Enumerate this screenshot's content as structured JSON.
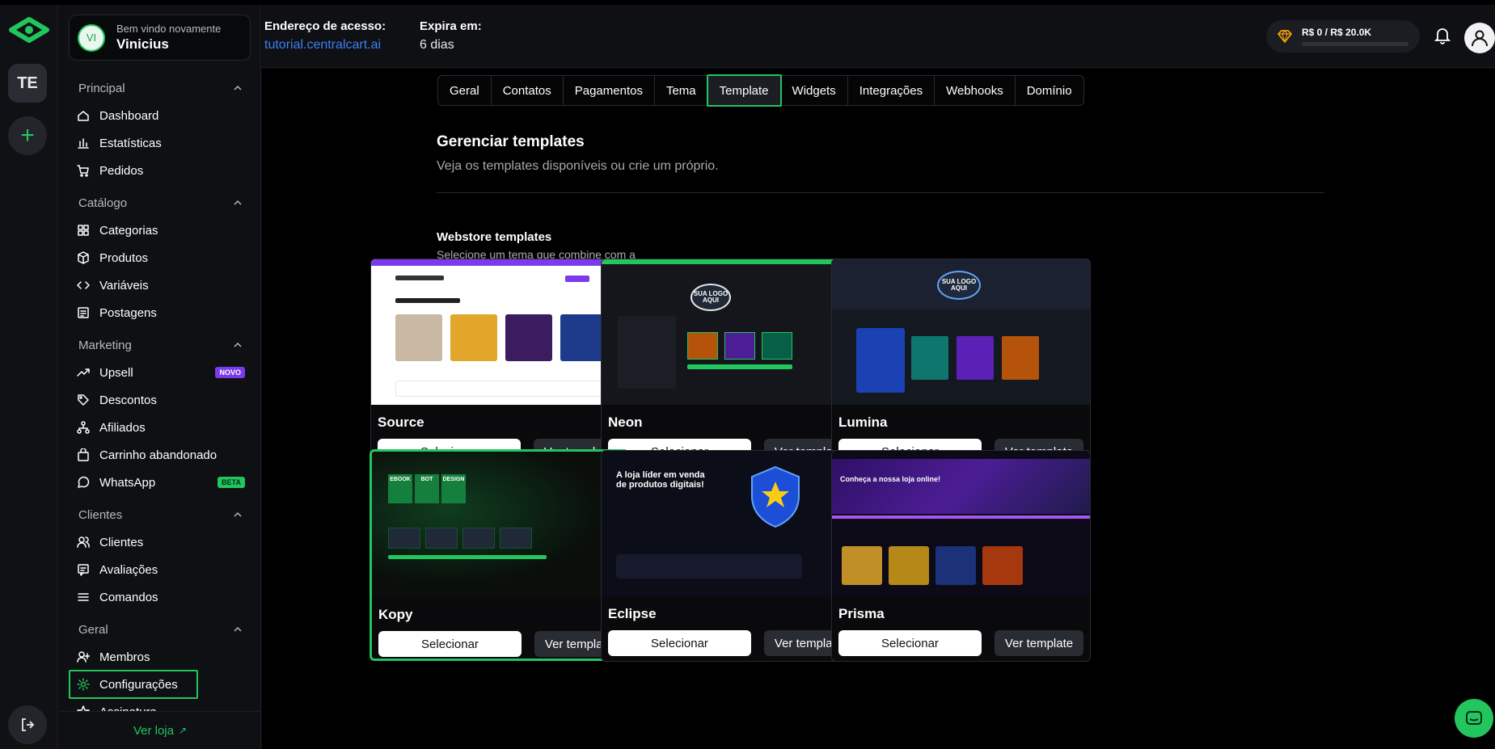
{
  "app": {
    "rail_initials": "TE",
    "accent": "#22c55e"
  },
  "welcome": {
    "avatar_initials": "VI",
    "greeting": "Bem vindo novamente",
    "name": "Vinicius"
  },
  "header": {
    "access_label": "Endereço de acesso:",
    "access_url": "tutorial.centralcart.ai",
    "expires_label": "Expira em:",
    "expires_value": "6 dias",
    "credit": "R$ 0 / R$ 20.0K"
  },
  "sidebar": {
    "sections": [
      {
        "title": "Principal",
        "items": [
          {
            "label": "Dashboard",
            "icon": "home-icon"
          },
          {
            "label": "Estatísticas",
            "icon": "chart-icon"
          },
          {
            "label": "Pedidos",
            "icon": "cart-icon"
          }
        ]
      },
      {
        "title": "Catálogo",
        "items": [
          {
            "label": "Categorias",
            "icon": "grid-icon"
          },
          {
            "label": "Produtos",
            "icon": "box-icon"
          },
          {
            "label": "Variáveis",
            "icon": "code-icon"
          },
          {
            "label": "Postagens",
            "icon": "post-icon"
          }
        ]
      },
      {
        "title": "Marketing",
        "items": [
          {
            "label": "Upsell",
            "icon": "trend-icon",
            "badge": "NOVO"
          },
          {
            "label": "Descontos",
            "icon": "tag-icon"
          },
          {
            "label": "Afiliados",
            "icon": "network-icon"
          },
          {
            "label": "Carrinho abandonado",
            "icon": "bag-icon"
          },
          {
            "label": "WhatsApp",
            "icon": "whatsapp-icon",
            "badge": "BETA"
          }
        ]
      },
      {
        "title": "Clientes",
        "items": [
          {
            "label": "Clientes",
            "icon": "users-icon"
          },
          {
            "label": "Avaliações",
            "icon": "review-icon"
          },
          {
            "label": "Comandos",
            "icon": "list-icon"
          }
        ]
      },
      {
        "title": "Geral",
        "items": [
          {
            "label": "Membros",
            "icon": "user-plus-icon"
          },
          {
            "label": "Configurações",
            "icon": "gear-icon",
            "active": true
          },
          {
            "label": "Assinatura",
            "icon": "star-icon"
          }
        ]
      }
    ],
    "see_store": "Ver loja"
  },
  "tabs": [
    {
      "label": "Geral"
    },
    {
      "label": "Contatos"
    },
    {
      "label": "Pagamentos"
    },
    {
      "label": "Tema"
    },
    {
      "label": "Template",
      "active": true
    },
    {
      "label": "Widgets"
    },
    {
      "label": "Integrações"
    },
    {
      "label": "Webhooks"
    },
    {
      "label": "Domínio"
    }
  ],
  "page": {
    "title": "Gerenciar templates",
    "subtitle": "Veja os templates disponíveis ou crie um próprio.",
    "webstore_title": "Webstore templates",
    "webstore_subtitle": "Selecione um tema que combine com a sua loja."
  },
  "templates": [
    {
      "name": "Source",
      "select": "Selecionar",
      "view": "Ver template",
      "theme": "light"
    },
    {
      "name": "Neon",
      "select": "Selecionar",
      "view": "Ver template",
      "theme": "neon",
      "preview_logo": "SUA LOGO AQUI"
    },
    {
      "name": "Lumina",
      "select": "Selecionar",
      "view": "Ver template",
      "theme": "lumina",
      "preview_logo": "SUA LOGO AQUI"
    },
    {
      "name": "Kopy",
      "select": "Selecionar",
      "view": "Ver template",
      "theme": "kopy",
      "selected": true,
      "preview_tags": [
        "EBOOK",
        "BOT",
        "DESIGN"
      ]
    },
    {
      "name": "Eclipse",
      "select": "Selecionar",
      "view": "Ver template",
      "theme": "eclipse",
      "preview_headline": "A loja líder em venda de produtos digitais!"
    },
    {
      "name": "Prisma",
      "select": "Selecionar",
      "view": "Ver template",
      "theme": "prisma",
      "preview_headline": "Conheça a nossa loja online!"
    }
  ]
}
